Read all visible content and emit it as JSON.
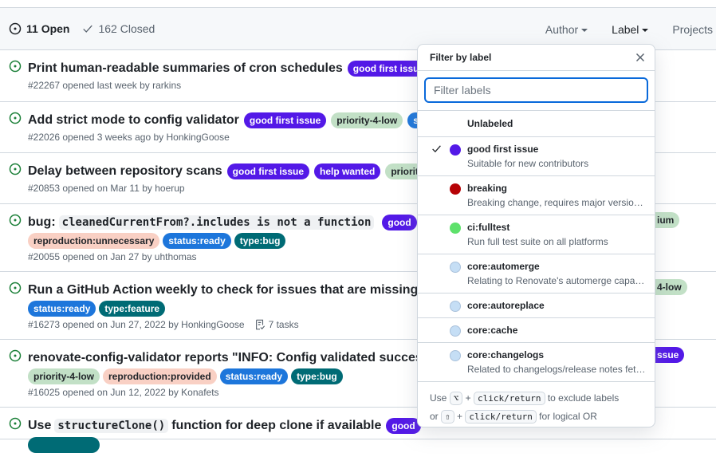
{
  "header": {
    "open_count": "11 Open",
    "closed_count": "162 Closed",
    "filters": [
      "Author",
      "Label",
      "Projects"
    ]
  },
  "issues": [
    {
      "title": "Print human-readable summaries of cron schedules",
      "labels": [
        {
          "text": "good first issue",
          "cls": "gfi"
        }
      ],
      "meta": "#22267 opened last week by rarkins"
    },
    {
      "title": "Add strict mode to config validator",
      "labels": [
        {
          "text": "good first issue",
          "cls": "gfi"
        },
        {
          "text": "priority-4-low",
          "cls": "low"
        },
        {
          "text": "s",
          "cls": "sr"
        }
      ],
      "meta": "#22026 opened 3 weeks ago by HonkingGoose"
    },
    {
      "title": "Delay between repository scans",
      "labels": [
        {
          "text": "good first issue",
          "cls": "gfi"
        },
        {
          "text": "help wanted",
          "cls": "hw"
        },
        {
          "text": "priorit",
          "cls": "low"
        }
      ],
      "meta": "#20853 opened on Mar 11 by hoerup"
    },
    {
      "title_prefix": "bug:",
      "title_code": "cleanedCurrentFrom?.includes is not a function",
      "inline_labels": [
        {
          "text": "good",
          "cls": "gfi"
        }
      ],
      "labels": [
        {
          "text": "reproduction:unnecessary",
          "cls": "rep"
        },
        {
          "text": "status:ready",
          "cls": "sr"
        },
        {
          "text": "type:bug",
          "cls": "tb"
        }
      ],
      "fragment": "ium",
      "meta": "#20055 opened on Jan 27 by uhthomas"
    },
    {
      "title": "Run a GitHub Action weekly to check for issues that are missing l",
      "labels": [
        {
          "text": "status:ready",
          "cls": "sr"
        },
        {
          "text": "type:feature",
          "cls": "tb"
        }
      ],
      "fragment": "4-low",
      "meta": "#16273 opened on Jun 27, 2022 by HonkingGoose",
      "tasks": "7 tasks"
    },
    {
      "title": "renovate-config-validator reports \"INFO: Config validated succes",
      "labels": [
        {
          "text": "priority-4-low",
          "cls": "low"
        },
        {
          "text": "reproduction:provided",
          "cls": "rep"
        },
        {
          "text": "status:ready",
          "cls": "sr"
        },
        {
          "text": "type:bug",
          "cls": "tb"
        }
      ],
      "fragment": "ssue",
      "meta": "#16025 opened on Jun 12, 2022 by Konafets"
    },
    {
      "title_prefix": "Use",
      "title_code": "structureClone()",
      "title_suffix": "function for deep clone if available",
      "inline_labels": [
        {
          "text": "good",
          "cls": "gfi"
        }
      ]
    }
  ],
  "dropdown": {
    "title": "Filter by label",
    "placeholder": "Filter labels",
    "unlabeled": "Unlabeled",
    "items": [
      {
        "name": "good first issue",
        "desc": "Suitable for new contributors",
        "color": "#5319e7",
        "checked": true
      },
      {
        "name": "breaking",
        "desc": "Breaking change, requires major version bump",
        "color": "#b60205"
      },
      {
        "name": "ci:fulltest",
        "desc": "Run full test suite on all platforms",
        "color": "#5ee16b"
      },
      {
        "name": "core:automerge",
        "desc": "Relating to Renovate's automerge capabilities",
        "color": "#c5def5"
      },
      {
        "name": "core:autoreplace",
        "desc": "",
        "color": "#c5def5"
      },
      {
        "name": "core:cache",
        "desc": "",
        "color": "#c5def5"
      },
      {
        "name": "core:changelogs",
        "desc": "Related to changelogs/release notes fetching",
        "color": "#c5def5"
      }
    ],
    "footer": {
      "use": "Use",
      "alt_key": "⌥",
      "plus": "+",
      "click": "click/return",
      "exclude": "to exclude labels",
      "or": "or",
      "shift_key": "⇧",
      "logical": "for logical OR"
    }
  }
}
